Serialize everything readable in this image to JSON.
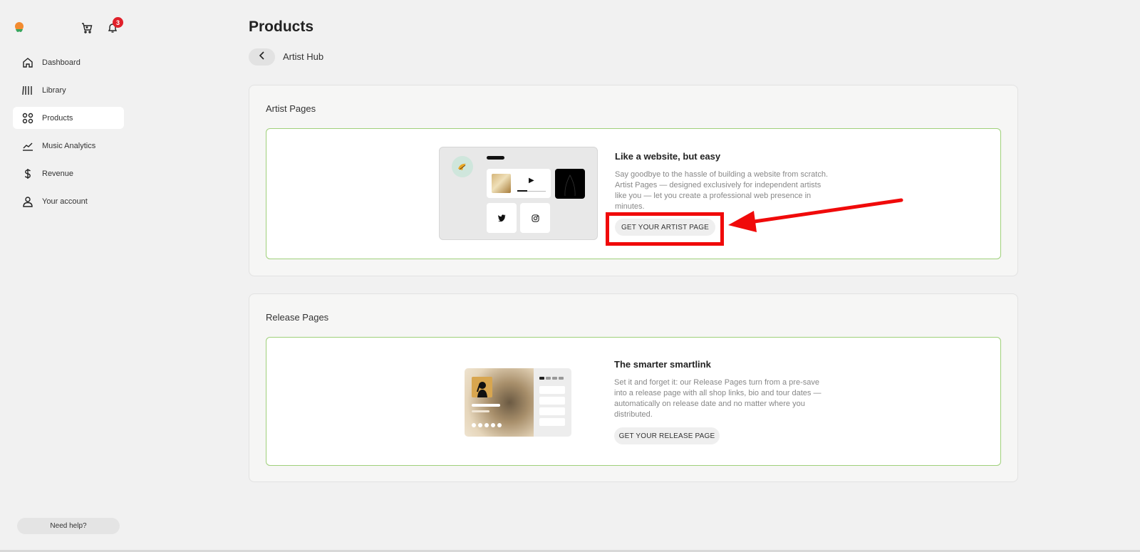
{
  "header": {
    "notification_count": "3"
  },
  "sidebar": {
    "items": [
      {
        "label": "Dashboard",
        "icon": "home-icon"
      },
      {
        "label": "Library",
        "icon": "library-icon"
      },
      {
        "label": "Products",
        "icon": "products-grid-icon",
        "active": true
      },
      {
        "label": "Music Analytics",
        "icon": "analytics-chart-icon"
      },
      {
        "label": "Revenue",
        "icon": "dollar-icon"
      },
      {
        "label": "Your account",
        "icon": "user-icon"
      }
    ],
    "help_label": "Need help?"
  },
  "main": {
    "title": "Products",
    "breadcrumb": "Artist Hub",
    "sections": [
      {
        "title": "Artist Pages",
        "card": {
          "heading": "Like a website, but easy",
          "description": "Say goodbye to the hassle of building a website from scratch. Artist Pages — designed exclusively for independent artists like you — let you create a professional web presence in minutes.",
          "button_label": "GET YOUR ARTIST PAGE"
        }
      },
      {
        "title": "Release Pages",
        "card": {
          "heading": "The smarter smartlink",
          "description": "Set it and forget it: our Release Pages turn from a pre-save into a release page with all shop links, bio and tour dates — automatically on release date and no matter where you distributed.",
          "button_label": "GET YOUR RELEASE PAGE"
        }
      }
    ]
  },
  "annotation": {
    "color": "#f00a0a"
  }
}
